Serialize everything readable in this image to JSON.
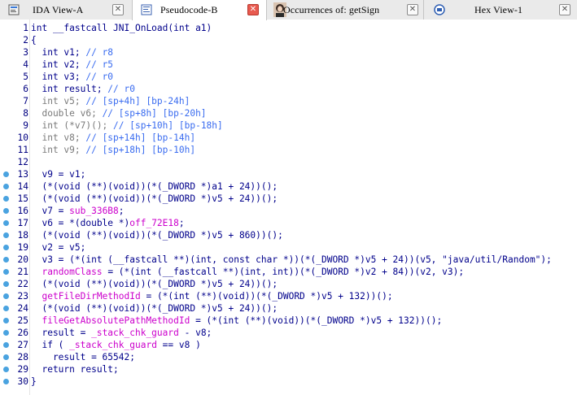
{
  "tabs": [
    {
      "label": "IDA View-A",
      "active": false,
      "close": "✕"
    },
    {
      "label": "Pseudocode-B",
      "active": true,
      "close": "✕"
    },
    {
      "label": "Occurrences of: getSign",
      "active": false,
      "close": "✕"
    },
    {
      "label": "Hex View-1",
      "active": false,
      "close": "✕"
    }
  ],
  "code_lines": [
    {
      "n": "1",
      "bp": false,
      "text": "int __fastcall JNI_OnLoad(int a1)"
    },
    {
      "n": "2",
      "bp": false,
      "text": "{"
    },
    {
      "n": "3",
      "bp": false,
      "text": "  int v1; // r8"
    },
    {
      "n": "4",
      "bp": false,
      "text": "  int v2; // r5"
    },
    {
      "n": "5",
      "bp": false,
      "text": "  int v3; // r0"
    },
    {
      "n": "6",
      "bp": false,
      "text": "  int result; // r0"
    },
    {
      "n": "7",
      "bp": false,
      "text": "  int v5; // [sp+4h] [bp-24h]"
    },
    {
      "n": "8",
      "bp": false,
      "text": "  double v6; // [sp+8h] [bp-20h]"
    },
    {
      "n": "9",
      "bp": false,
      "text": "  int (*v7)(); // [sp+10h] [bp-18h]"
    },
    {
      "n": "10",
      "bp": false,
      "text": "  int v8; // [sp+14h] [bp-14h]"
    },
    {
      "n": "11",
      "bp": false,
      "text": "  int v9; // [sp+18h] [bp-10h]"
    },
    {
      "n": "12",
      "bp": false,
      "text": ""
    },
    {
      "n": "13",
      "bp": true,
      "text": "  v9 = v1;"
    },
    {
      "n": "14",
      "bp": true,
      "text": "  (*(void (**)(void))(*(_DWORD *)a1 + 24))();"
    },
    {
      "n": "15",
      "bp": true,
      "text": "  (*(void (**)(void))(*(_DWORD *)v5 + 24))();"
    },
    {
      "n": "16",
      "bp": true,
      "text": "  v7 = sub_336B8;"
    },
    {
      "n": "17",
      "bp": true,
      "text": "  v6 = *(double *)off_72E18;"
    },
    {
      "n": "18",
      "bp": true,
      "text": "  (*(void (**)(void))(*(_DWORD *)v5 + 860))();"
    },
    {
      "n": "19",
      "bp": true,
      "text": "  v2 = v5;"
    },
    {
      "n": "20",
      "bp": true,
      "text": "  v3 = (*(int (__fastcall **)(int, const char *))(*(_DWORD *)v5 + 24))(v5, \"java/util/Random\");"
    },
    {
      "n": "21",
      "bp": true,
      "text": "  randomClass = (*(int (__fastcall **)(int, int))(*(_DWORD *)v2 + 84))(v2, v3);"
    },
    {
      "n": "22",
      "bp": true,
      "text": "  (*(void (**)(void))(*(_DWORD *)v5 + 24))();"
    },
    {
      "n": "23",
      "bp": true,
      "text": "  getFileDirMethodId = (*(int (**)(void))(*(_DWORD *)v5 + 132))();"
    },
    {
      "n": "24",
      "bp": true,
      "text": "  (*(void (**)(void))(*(_DWORD *)v5 + 24))();"
    },
    {
      "n": "25",
      "bp": true,
      "text": "  fileGetAbsolutePathMethodId = (*(int (**)(void))(*(_DWORD *)v5 + 132))();"
    },
    {
      "n": "26",
      "bp": true,
      "text": "  result = _stack_chk_guard - v8;"
    },
    {
      "n": "27",
      "bp": true,
      "text": "  if ( _stack_chk_guard == v8 )"
    },
    {
      "n": "28",
      "bp": true,
      "text": "    result = 65542;"
    },
    {
      "n": "29",
      "bp": true,
      "text": "  return result;"
    },
    {
      "n": "30",
      "bp": true,
      "text": "}"
    }
  ],
  "colors": {
    "line_number": "#000080",
    "code": "#00008b",
    "comment": "#3a6cf0",
    "global": "#cc00cc",
    "breakpoint": "#4aa3e0"
  },
  "icons": [
    "ida-view-icon",
    "pseudocode-icon",
    "occurrences-icon",
    "hex-view-icon"
  ]
}
